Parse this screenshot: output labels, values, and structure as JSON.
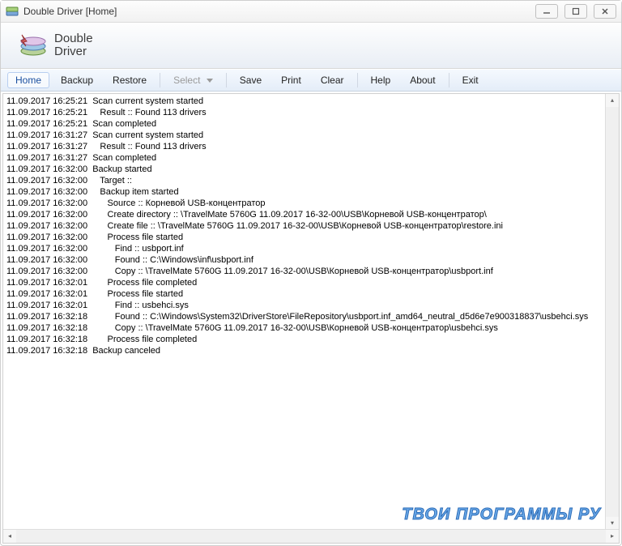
{
  "window": {
    "title": "Double Driver [Home]"
  },
  "logo": {
    "line1": "Double",
    "line2": "Driver"
  },
  "toolbar": {
    "home": "Home",
    "backup": "Backup",
    "restore": "Restore",
    "select": "Select",
    "save": "Save",
    "print": "Print",
    "clear": "Clear",
    "help": "Help",
    "about": "About",
    "exit": "Exit"
  },
  "watermark": "ТВОИ ПРОГРАММЫ РУ",
  "log": [
    {
      "ts": "11.09.2017 16:25:21",
      "indent": 0,
      "msg": "Scan current system started"
    },
    {
      "ts": "11.09.2017 16:25:21",
      "indent": 1,
      "msg": "Result :: Found 113 drivers"
    },
    {
      "ts": "11.09.2017 16:25:21",
      "indent": 0,
      "msg": "Scan completed"
    },
    {
      "ts": "11.09.2017 16:31:27",
      "indent": 0,
      "msg": "Scan current system started"
    },
    {
      "ts": "11.09.2017 16:31:27",
      "indent": 1,
      "msg": "Result :: Found 113 drivers"
    },
    {
      "ts": "11.09.2017 16:31:27",
      "indent": 0,
      "msg": "Scan completed"
    },
    {
      "ts": "11.09.2017 16:32:00",
      "indent": 0,
      "msg": "Backup started"
    },
    {
      "ts": "11.09.2017 16:32:00",
      "indent": 1,
      "msg": "Target ::"
    },
    {
      "ts": "11.09.2017 16:32:00",
      "indent": 1,
      "msg": "Backup item started"
    },
    {
      "ts": "11.09.2017 16:32:00",
      "indent": 2,
      "msg": "Source :: Корневой USB-концентратор"
    },
    {
      "ts": "11.09.2017 16:32:00",
      "indent": 2,
      "msg": "Create directory :: \\TravelMate 5760G 11.09.2017 16-32-00\\USB\\Корневой USB-концентратор\\"
    },
    {
      "ts": "11.09.2017 16:32:00",
      "indent": 2,
      "msg": "Create file :: \\TravelMate 5760G 11.09.2017 16-32-00\\USB\\Корневой USB-концентратор\\restore.ini"
    },
    {
      "ts": "11.09.2017 16:32:00",
      "indent": 2,
      "msg": "Process file started"
    },
    {
      "ts": "11.09.2017 16:32:00",
      "indent": 3,
      "msg": "Find :: usbport.inf"
    },
    {
      "ts": "11.09.2017 16:32:00",
      "indent": 3,
      "msg": "Found :: C:\\Windows\\inf\\usbport.inf"
    },
    {
      "ts": "11.09.2017 16:32:00",
      "indent": 3,
      "msg": "Copy :: \\TravelMate 5760G 11.09.2017 16-32-00\\USB\\Корневой USB-концентратор\\usbport.inf"
    },
    {
      "ts": "11.09.2017 16:32:01",
      "indent": 2,
      "msg": "Process file completed"
    },
    {
      "ts": "11.09.2017 16:32:01",
      "indent": 2,
      "msg": "Process file started"
    },
    {
      "ts": "11.09.2017 16:32:01",
      "indent": 3,
      "msg": "Find :: usbehci.sys"
    },
    {
      "ts": "11.09.2017 16:32:18",
      "indent": 3,
      "msg": "Found :: C:\\Windows\\System32\\DriverStore\\FileRepository\\usbport.inf_amd64_neutral_d5d6e7e900318837\\usbehci.sys"
    },
    {
      "ts": "11.09.2017 16:32:18",
      "indent": 3,
      "msg": "Copy :: \\TravelMate 5760G 11.09.2017 16-32-00\\USB\\Корневой USB-концентратор\\usbehci.sys"
    },
    {
      "ts": "11.09.2017 16:32:18",
      "indent": 2,
      "msg": "Process file completed"
    },
    {
      "ts": "11.09.2017 16:32:18",
      "indent": 0,
      "msg": "Backup canceled"
    }
  ]
}
